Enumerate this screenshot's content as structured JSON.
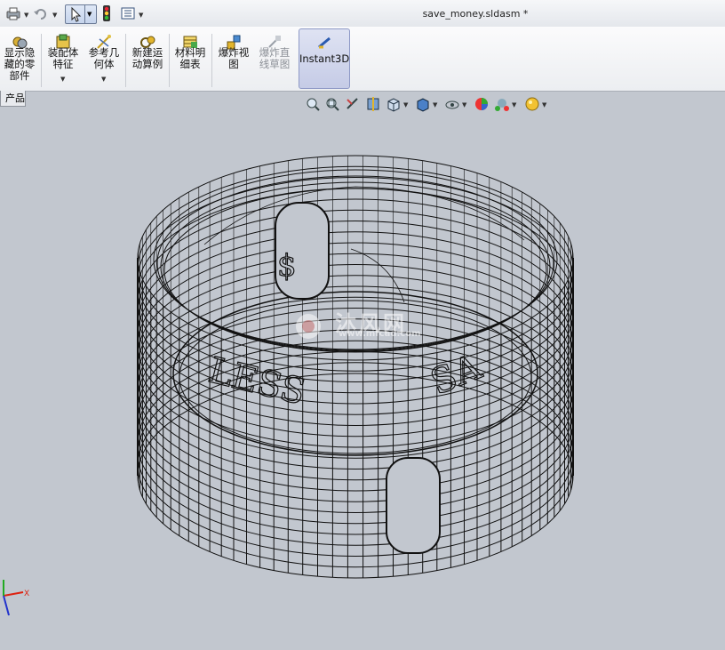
{
  "window": {
    "title": "save_money.sldasm *"
  },
  "quick_access": {
    "icons": [
      "printer-icon",
      "undo-icon",
      "select-pointer-icon",
      "rebuild-icon",
      "file-properties-icon"
    ]
  },
  "ribbon": {
    "buttons": [
      {
        "label": "显示隐\n藏的零\n部件",
        "icon": "show-hidden-components-icon",
        "disabled": false,
        "has_dropdown": false
      },
      {
        "label": "装配体\n特征",
        "icon": "assembly-features-icon",
        "disabled": false,
        "has_dropdown": true
      },
      {
        "label": "参考几\n何体",
        "icon": "reference-geometry-icon",
        "disabled": false,
        "has_dropdown": true
      },
      {
        "label": "新建运\n动算例",
        "icon": "new-motion-study-icon",
        "disabled": false,
        "has_dropdown": false
      },
      {
        "label": "材料明\n细表",
        "icon": "bill-of-materials-icon",
        "disabled": false,
        "has_dropdown": false
      },
      {
        "label": "爆炸视\n图",
        "icon": "exploded-view-icon",
        "disabled": false,
        "has_dropdown": false
      },
      {
        "label": "爆炸直\n线草图",
        "icon": "explode-line-sketch-icon",
        "disabled": true,
        "has_dropdown": false
      },
      {
        "label": "Instant3D",
        "icon": "instant3d-icon",
        "disabled": false,
        "has_dropdown": false,
        "active": true
      }
    ]
  },
  "tabs": {
    "partial_label": "产品"
  },
  "view_toolbar": {
    "icons": [
      "zoom-to-fit-icon",
      "zoom-to-area-icon",
      "previous-view-icon",
      "section-view-icon",
      "view-orientation-icon",
      "display-style-icon",
      "hide-show-items-icon",
      "edit-appearance-icon",
      "apply-scene-icon",
      "view-settings-icon"
    ]
  },
  "model": {
    "engraved_text_left": "LESS",
    "engraved_text_right": "SA",
    "symbol": "$",
    "style": "wireframe"
  },
  "watermark": {
    "main": "沐风网",
    "url": "www.mfcad.com"
  },
  "triad": {
    "x_label": "X"
  },
  "colors": {
    "viewport_bg": "#c2c7cf",
    "active_button": "#c5cbe6",
    "wire": "#111111"
  }
}
